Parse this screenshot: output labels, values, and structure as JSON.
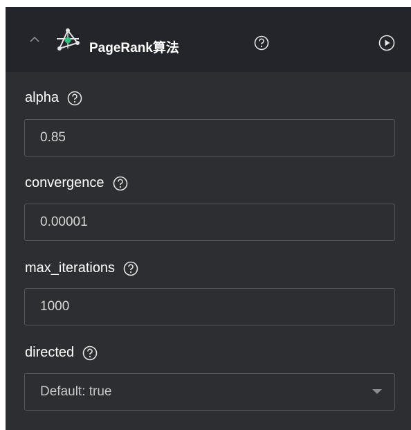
{
  "header": {
    "title": "PageRank算法",
    "icons": {
      "collapse": "chevron-up-icon",
      "algorithm": "graph-nodes-icon",
      "help": "question-circle-icon",
      "run": "play-circle-icon"
    }
  },
  "params": [
    {
      "label": "alpha",
      "value": "0.85"
    },
    {
      "label": "convergence",
      "value": "0.00001"
    },
    {
      "label": "max_iterations",
      "value": "1000"
    },
    {
      "label": "directed",
      "value": "Default: true"
    }
  ],
  "colors": {
    "panel_bg": "#2d2e32",
    "header_bg": "#24252a",
    "accent_green": "#2ec27e",
    "border": "#55575d",
    "text": "#ffffff"
  }
}
